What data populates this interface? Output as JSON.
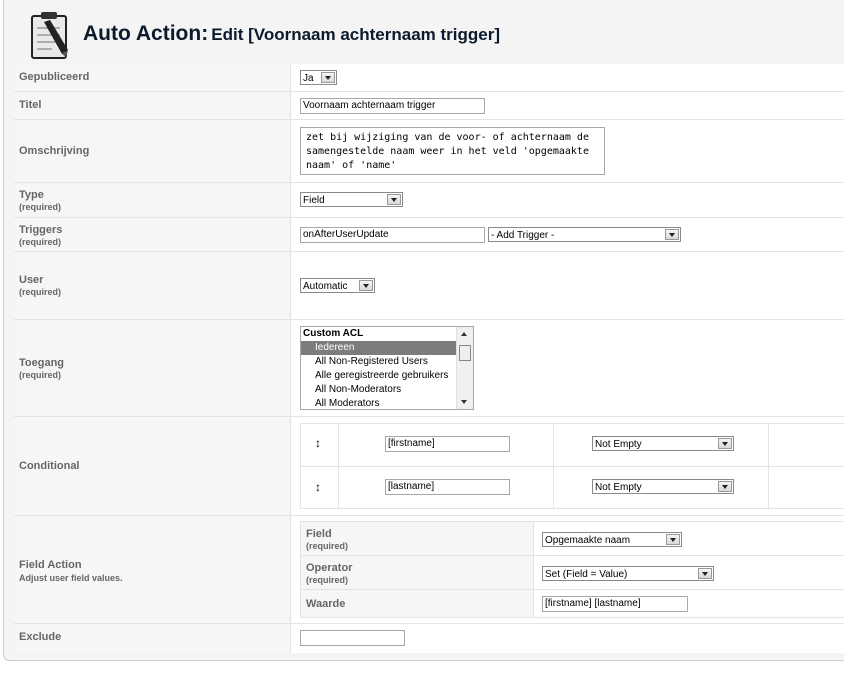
{
  "header": {
    "title_main": "Auto Action:",
    "title_sub": "Edit [Voornaam achternaam trigger]",
    "icon": "clipboard-pencil-icon"
  },
  "form": {
    "published": {
      "label": "Gepubliceerd",
      "value": "Ja"
    },
    "title": {
      "label": "Titel",
      "value": "Voornaam achternaam trigger"
    },
    "description": {
      "label": "Omschrijving",
      "value": "zet bij wijziging van de voor- of achternaam de samengestelde naam weer in het veld 'opgemaakte naam' of 'name'"
    },
    "type": {
      "label": "Type",
      "required": "(required)",
      "value": "Field"
    },
    "triggers": {
      "label": "Triggers",
      "required": "(required)",
      "value": "onAfterUserUpdate",
      "add_label": "- Add Trigger -"
    },
    "user": {
      "label": "User",
      "required": "(required)",
      "value": "Automatic"
    },
    "access": {
      "label": "Toegang",
      "required": "(required)",
      "group": "Custom ACL",
      "options": [
        "Iedereen",
        "All Non-Registered Users",
        "Alle geregistreerde gebruikers",
        "All Non-Moderators",
        "All Moderators"
      ],
      "selected": "Iedereen"
    },
    "conditional": {
      "label": "Conditional",
      "rows": [
        {
          "field": "[firstname]",
          "operator": "Not Empty"
        },
        {
          "field": "[lastname]",
          "operator": "Not Empty"
        }
      ],
      "drag_glyph": "↕"
    },
    "field_action": {
      "label": "Field Action",
      "description": "Adjust user field values.",
      "field_label": "Field",
      "field_required": "(required)",
      "field_value": "Opgemaakte naam",
      "operator_label": "Operator",
      "operator_required": "(required)",
      "operator_value": "Set (Field = Value)",
      "value_label": "Waarde",
      "value_value": "[firstname] [lastname]"
    },
    "exclude": {
      "label": "Exclude",
      "value": ""
    }
  },
  "colors": {
    "label_bg": "#f6f6f6",
    "page_bg": "#f4f4f4",
    "title": "#0b1a2c",
    "selected_option": "#7c7c7c"
  }
}
